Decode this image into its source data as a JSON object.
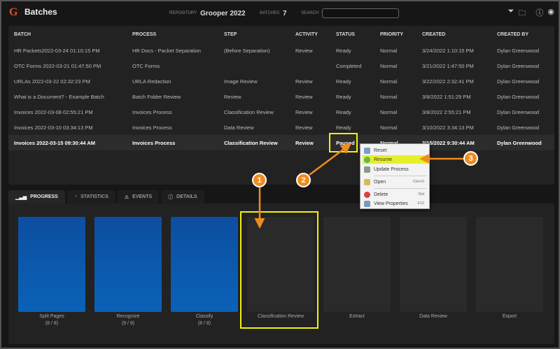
{
  "header": {
    "title": "Batches",
    "repository_label": "REPOSITORY",
    "repository": "Grooper 2022",
    "batches_label": "BATCHES",
    "batches_count": "7",
    "search_label": "SEARCH",
    "search_value": ""
  },
  "columns": [
    "BATCH",
    "PROCESS",
    "STEP",
    "ACTIVITY",
    "STATUS",
    "PRIORITY",
    "CREATED",
    "CREATED BY"
  ],
  "rows": [
    [
      "HR Packets2022-03-24 01:10:15 PM",
      "HR Docs - Packet Separation",
      "(Before Separation)",
      "Review",
      "Ready",
      "Normal",
      "3/24/2022 1:10:15 PM",
      "Dylan Greenwood"
    ],
    [
      "OTC Forms 2022-03-21 01:47:50 PM",
      "OTC Forms",
      "",
      "",
      "Completed",
      "Normal",
      "3/21/2022 1:47:50 PM",
      "Dylan Greenwood"
    ],
    [
      "URLAs 2022-03-22 02:32:23 PM",
      "URLA Redaction",
      "Image Review",
      "Review",
      "Ready",
      "Normal",
      "3/22/2022 2:32:41 PM",
      "Dylan Greenwood"
    ],
    [
      "What is a Document? - Example Batch",
      "Batch Folder Review",
      "Review",
      "Review",
      "Ready",
      "Normal",
      "3/8/2022 1:51:29 PM",
      "Dylan Greenwood"
    ],
    [
      "Invoices 2022-03-08 02:55:21 PM",
      "Invoices Process",
      "Classification Review",
      "Review",
      "Ready",
      "Normal",
      "3/8/2022 2:55:21 PM",
      "Dylan Greenwood"
    ],
    [
      "Invoices 2022-03-10 03:34:13 PM",
      "Invoices Process",
      "Data Review",
      "Review",
      "Ready",
      "Normal",
      "3/10/2022 3:34:13 PM",
      "Dylan Greenwood"
    ],
    [
      "Invoices 2022-03-15 09:30:44 AM",
      "Invoices Process",
      "Classification Review",
      "Review",
      "Paused",
      "Normal",
      "3/15/2022 9:30:44 AM",
      "Dylan Greenwood"
    ]
  ],
  "tabs": [
    "PROGRESS",
    "STATISTICS",
    "EVENTS",
    "DETAILS"
  ],
  "steps": [
    {
      "label": "Split Pages",
      "count": "(8 / 8)",
      "progress": 1
    },
    {
      "label": "Recognize",
      "count": "(9 / 9)",
      "progress": 1
    },
    {
      "label": "Classify",
      "count": "(8 / 8)",
      "progress": 1
    },
    {
      "label": "Classification Review",
      "count": "",
      "progress": 0
    },
    {
      "label": "Extract",
      "count": "",
      "progress": 0
    },
    {
      "label": "Data Review",
      "count": "",
      "progress": 0
    },
    {
      "label": "Export",
      "count": "",
      "progress": 0
    }
  ],
  "context_menu": [
    {
      "label": "Reset",
      "shortcut": ""
    },
    {
      "label": "Resume",
      "shortcut": ""
    },
    {
      "label": "Update Process",
      "shortcut": ""
    },
    {
      "label": "Open",
      "shortcut": "Ctrl+O"
    },
    {
      "label": "Delete",
      "shortcut": "Del"
    },
    {
      "label": "View Properties",
      "shortcut": "F12"
    }
  ],
  "annotations": [
    "1",
    "2",
    "3"
  ],
  "colors": {
    "accent": "#f08c1c",
    "highlight": "#f2f20a",
    "bar": "#0a5aac"
  }
}
